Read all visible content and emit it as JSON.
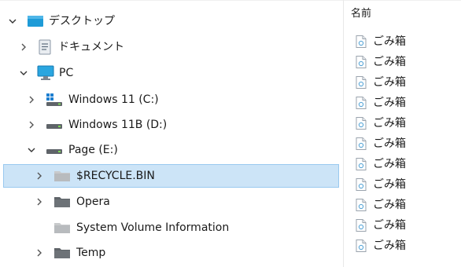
{
  "tree": {
    "items": [
      {
        "label": "デスクトップ",
        "icon": "desktop-folder-icon",
        "expanded": true
      },
      {
        "label": "ドキュメント",
        "icon": "documents-icon",
        "expanded": false
      },
      {
        "label": "PC",
        "icon": "pc-monitor-icon",
        "expanded": true
      },
      {
        "label": "Windows 11 (C:)",
        "icon": "windows-drive-icon",
        "expanded": false
      },
      {
        "label": "Windows 11B (D:)",
        "icon": "drive-icon",
        "expanded": false
      },
      {
        "label": "Page (E:)",
        "icon": "drive-icon",
        "expanded": true
      },
      {
        "label": "$RECYCLE.BIN",
        "icon": "folder-icon",
        "expanded": false,
        "selected": true
      },
      {
        "label": "Opera",
        "icon": "folder-icon",
        "expanded": false
      },
      {
        "label": "System Volume Information",
        "icon": "folder-icon",
        "expanded": false
      },
      {
        "label": "Temp",
        "icon": "folder-icon",
        "expanded": false
      }
    ]
  },
  "list": {
    "column_header": "名前",
    "files": [
      "ごみ箱",
      "ごみ箱",
      "ごみ箱",
      "ごみ箱",
      "ごみ箱",
      "ごみ箱",
      "ごみ箱",
      "ごみ箱",
      "ごみ箱",
      "ごみ箱",
      "ごみ箱"
    ]
  },
  "colors": {
    "selection_fill": "#cce4f7",
    "selection_border": "#99c9ef",
    "folder_dark": "#5f6469",
    "folder_light": "#c8cacc",
    "desktop_blue": "#1e9bd7"
  }
}
